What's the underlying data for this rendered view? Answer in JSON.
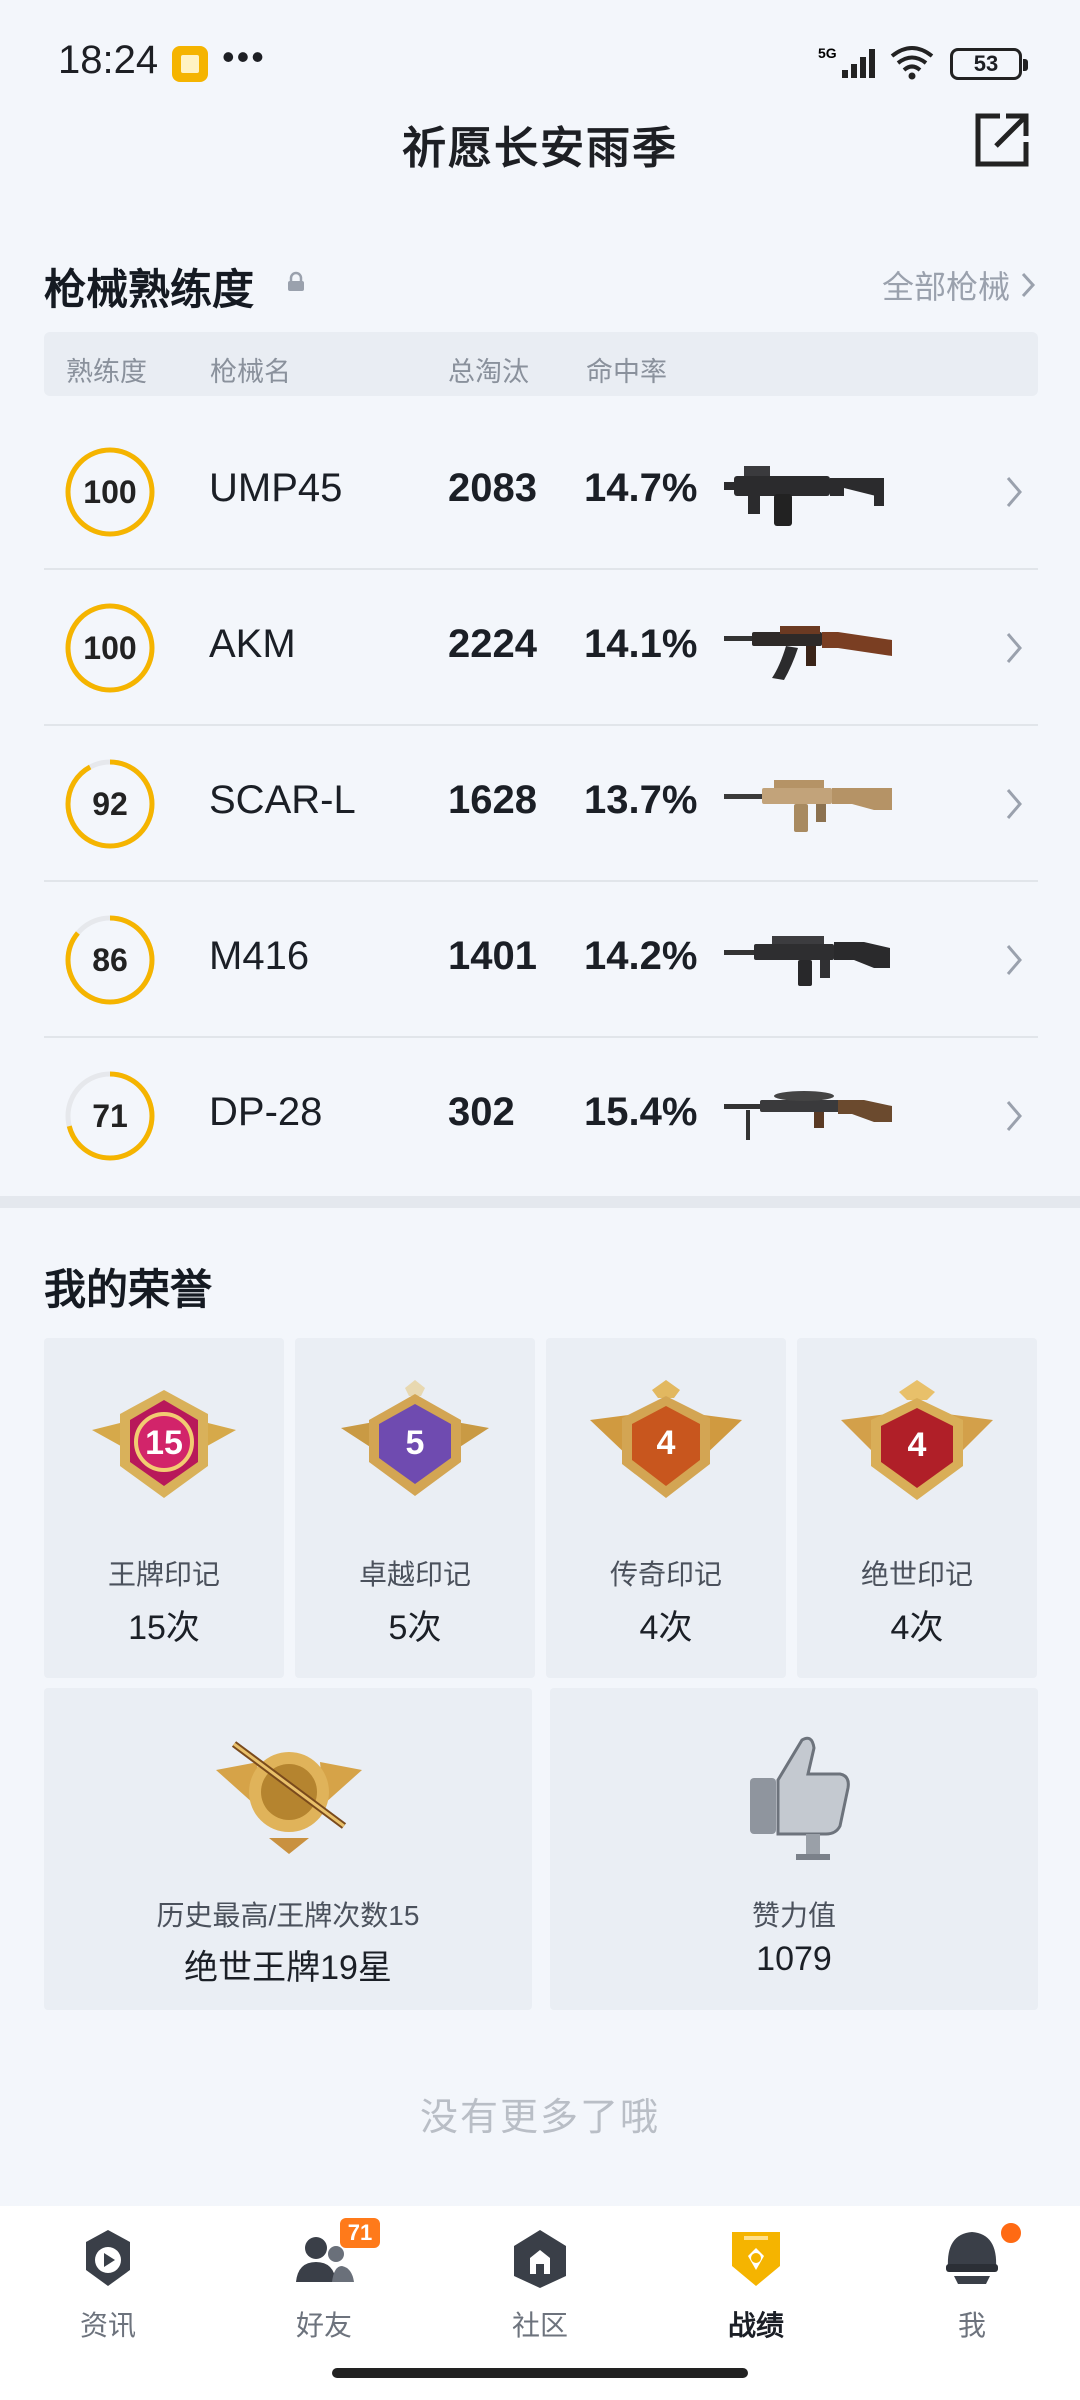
{
  "status_bar": {
    "time": "18:24",
    "more": "•••",
    "network": "5G",
    "battery": "53"
  },
  "header": {
    "title": "祈愿长安雨季"
  },
  "weapons": {
    "title": "枪械熟练度",
    "all_link": "全部枪械",
    "columns": {
      "mastery": "熟练度",
      "name": "枪械名",
      "kills": "总淘汰",
      "hit_rate": "命中率"
    },
    "rows": [
      {
        "mastery": "100",
        "mastery_value": 100,
        "name": "UMP45",
        "kills": "2083",
        "hit_rate": "14.7%"
      },
      {
        "mastery": "100",
        "mastery_value": 100,
        "name": "AKM",
        "kills": "2224",
        "hit_rate": "14.1%"
      },
      {
        "mastery": "92",
        "mastery_value": 92,
        "name": "SCAR-L",
        "kills": "1628",
        "hit_rate": "13.7%"
      },
      {
        "mastery": "86",
        "mastery_value": 86,
        "name": "M416",
        "kills": "1401",
        "hit_rate": "14.2%"
      },
      {
        "mastery": "71",
        "mastery_value": 71,
        "name": "DP-28",
        "kills": "302",
        "hit_rate": "15.4%"
      }
    ]
  },
  "honors": {
    "title": "我的荣誉",
    "cards": [
      {
        "badge_number": "15",
        "label": "王牌印记",
        "count": "15次",
        "icon": "ace-emblem-icon"
      },
      {
        "badge_number": "5",
        "label": "卓越印记",
        "count": "5次",
        "icon": "excellence-emblem-icon"
      },
      {
        "badge_number": "4",
        "label": "传奇印记",
        "count": "4次",
        "icon": "legend-emblem-icon"
      },
      {
        "badge_number": "4",
        "label": "绝世印记",
        "count": "4次",
        "icon": "peerless-emblem-icon"
      }
    ],
    "highest": {
      "label": "历史最高/王牌次数15",
      "value": "绝世王牌19星",
      "icon": "rank-emblem-icon"
    },
    "likes": {
      "label": "赞力值",
      "value": "1079",
      "icon": "thumbs-up-icon"
    }
  },
  "footer": {
    "no_more": "没有更多了哦"
  },
  "nav": {
    "items": [
      {
        "label": "资讯",
        "icon": "news-icon"
      },
      {
        "label": "好友",
        "icon": "friends-icon",
        "badge": "71"
      },
      {
        "label": "社区",
        "icon": "community-icon"
      },
      {
        "label": "战绩",
        "icon": "record-icon",
        "active": true
      },
      {
        "label": "我",
        "icon": "profile-icon",
        "dot": true
      }
    ]
  },
  "colors": {
    "accent": "#f5b400",
    "ring_track": "#e6e8ec",
    "badge": "#ff7a1a"
  }
}
